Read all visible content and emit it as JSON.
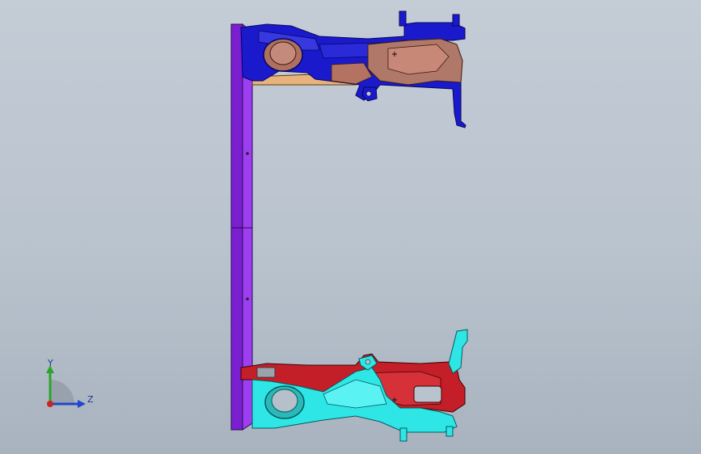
{
  "viewport": {
    "background_top": "#c4ccd6",
    "background_bottom": "#a9b3bf"
  },
  "model": {
    "parts": [
      {
        "name": "base-plate",
        "color": "#8a2be2"
      },
      {
        "name": "upper-fixture-frame",
        "color": "#1e1ecc"
      },
      {
        "name": "upper-casting",
        "color": "#b5786a"
      },
      {
        "name": "upper-insert",
        "color": "#e8b27a"
      },
      {
        "name": "lower-fixture-frame",
        "color": "#c41e28"
      },
      {
        "name": "lower-casting",
        "color": "#2ee6e6"
      }
    ]
  },
  "triad": {
    "y_label": "Y",
    "z_label": "Z",
    "y_color": "#2aa52a",
    "z_color": "#2244cc",
    "x_color": "#cc2222"
  }
}
